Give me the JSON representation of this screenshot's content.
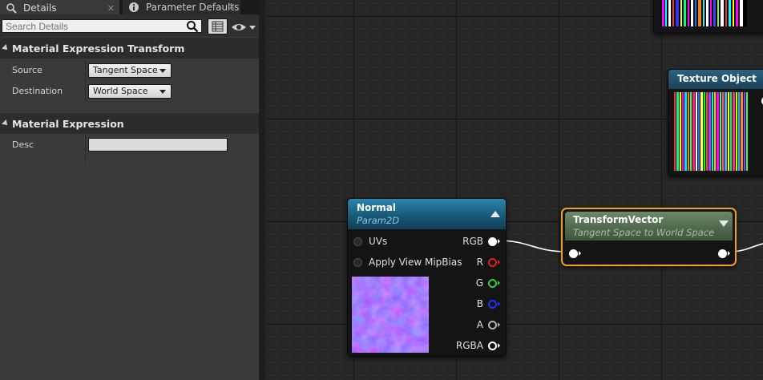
{
  "tabs": [
    {
      "label": "Details",
      "icon": "magnifier-icon",
      "closable": true
    },
    {
      "label": "Parameter Defaults",
      "icon": "info-icon",
      "closable": true
    }
  ],
  "search": {
    "placeholder": "Search Details"
  },
  "categories": [
    {
      "title": "Material Expression Transform",
      "properties": [
        {
          "label": "Source",
          "value": "Tangent Space"
        },
        {
          "label": "Destination",
          "value": "World Space"
        }
      ]
    },
    {
      "title": "Material Expression",
      "properties": [
        {
          "label": "Desc",
          "value": ""
        }
      ]
    }
  ],
  "nodes": {
    "normal": {
      "title": "Normal",
      "subtitle": "Param2D",
      "inputs": [
        {
          "label": "UVs"
        },
        {
          "label": "Apply View MipBias"
        }
      ],
      "outputs": [
        {
          "label": "RGB",
          "color": "#ffffff"
        },
        {
          "label": "R",
          "color": "#e02020"
        },
        {
          "label": "G",
          "color": "#30d030"
        },
        {
          "label": "B",
          "color": "#2030ff"
        },
        {
          "label": "A",
          "color": "#b0b0b0"
        },
        {
          "label": "RGBA",
          "color": "#ffffff"
        }
      ]
    },
    "transform": {
      "title": "TransformVector",
      "subtitle": "Tangent Space to World Space"
    },
    "texture_object": {
      "title": "Texture Object"
    }
  },
  "colors": {
    "selection": "#f0a020",
    "normal_header": "#1d6b8f",
    "transform_header": "#587156",
    "wire": "#ffffff"
  }
}
